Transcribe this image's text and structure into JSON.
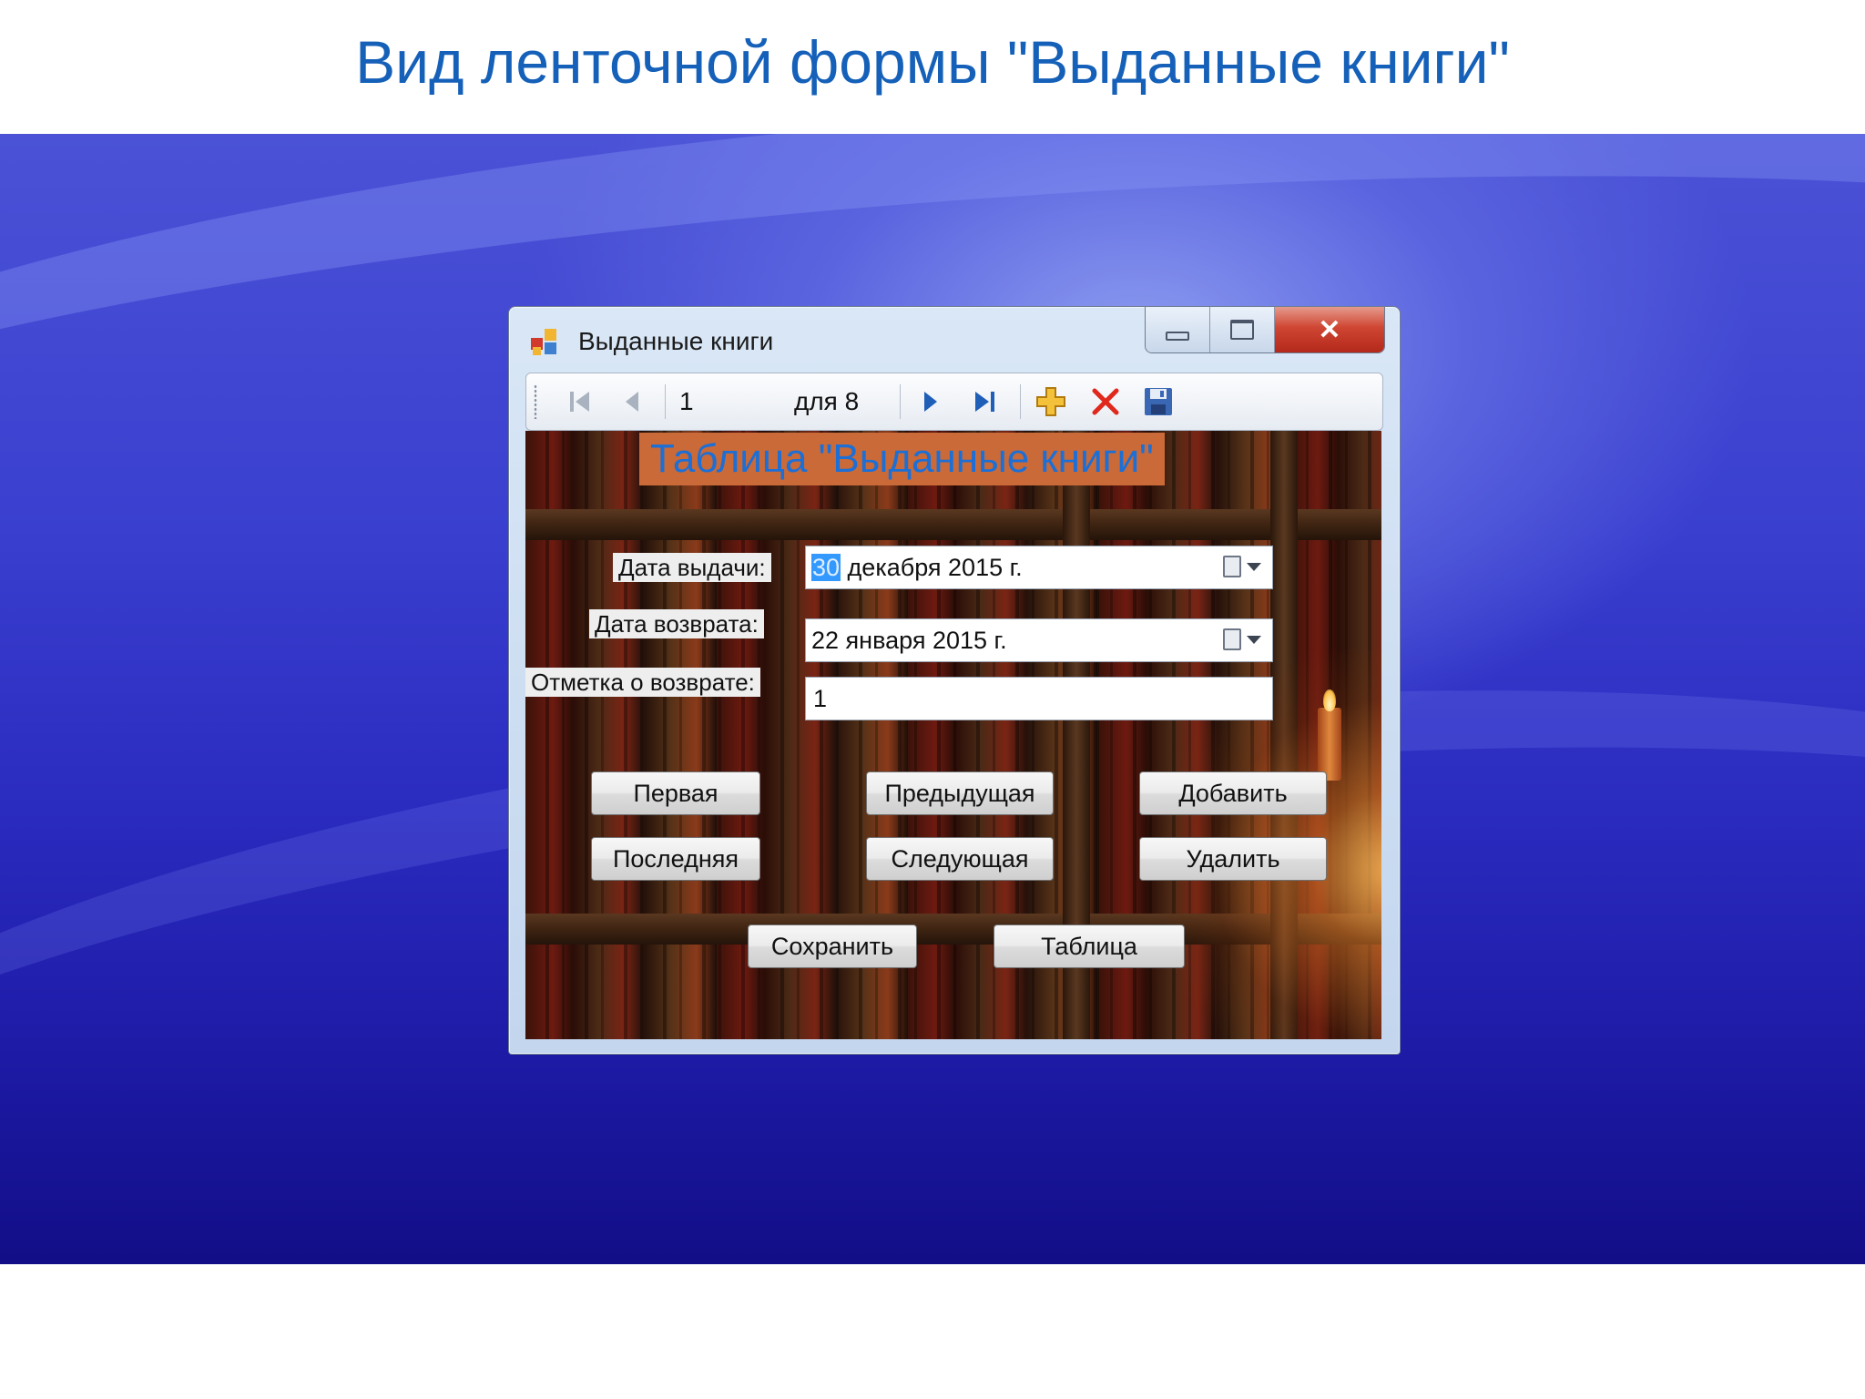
{
  "slide": {
    "title": "Вид ленточной формы \"Выданные книги\""
  },
  "window": {
    "title": "Выданные книги",
    "close_glyph": "✕",
    "icon": "form-app-icon"
  },
  "navigator": {
    "position": "1",
    "count_label": "для 8",
    "icons": [
      "move-first-icon",
      "move-previous-icon",
      "move-next-icon",
      "move-last-icon",
      "add-new-icon",
      "delete-icon",
      "save-icon"
    ]
  },
  "form": {
    "heading": "Таблица \"Выданные книги\"",
    "issue_date": {
      "label": "Дата выдачи:",
      "day": "30",
      "rest": " декабря  2015 г."
    },
    "return_date": {
      "label": "Дата возврата:",
      "value": "22  января   2015 г."
    },
    "return_mark": {
      "label": "Отметка о возврате:",
      "value": "1"
    }
  },
  "buttons": {
    "first": "Первая",
    "previous": "Предыдущая",
    "add": "Добавить",
    "last": "Последняя",
    "next": "Следующая",
    "delete": "Удалить",
    "save": "Сохранить",
    "table": "Таблица"
  },
  "colors": {
    "title_text": "#1560b8",
    "heading_bg": "#c96a38",
    "heading_text": "#1c6fd6",
    "close_button": "#cf4633",
    "selection": "#3399ff"
  }
}
